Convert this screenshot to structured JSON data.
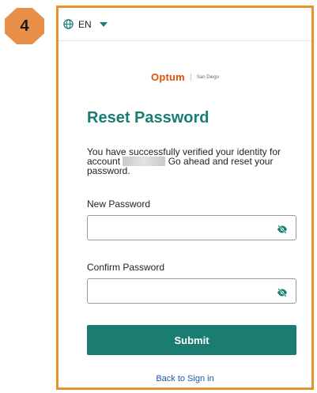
{
  "step": {
    "number": "4"
  },
  "language": {
    "code": "EN",
    "icon": "globe-icon"
  },
  "brand": {
    "name": "Optum",
    "sub": "San Diego"
  },
  "page": {
    "title": "Reset Password",
    "intro_part1": "You have successfully verified your identity for account",
    "intro_part2": "Go ahead and reset your password."
  },
  "form": {
    "new_password_label": "New Password",
    "new_password_value": "",
    "confirm_password_label": "Confirm Password",
    "confirm_password_value": "",
    "visibility_icon": "eye-slash-icon",
    "submit_label": "Submit",
    "back_link": "Back to Sign in"
  },
  "colors": {
    "accent": "#1b7d72",
    "brand": "#e35205",
    "frame": "#e8922e",
    "badge": "#e8904a",
    "link": "#1f56a8"
  }
}
